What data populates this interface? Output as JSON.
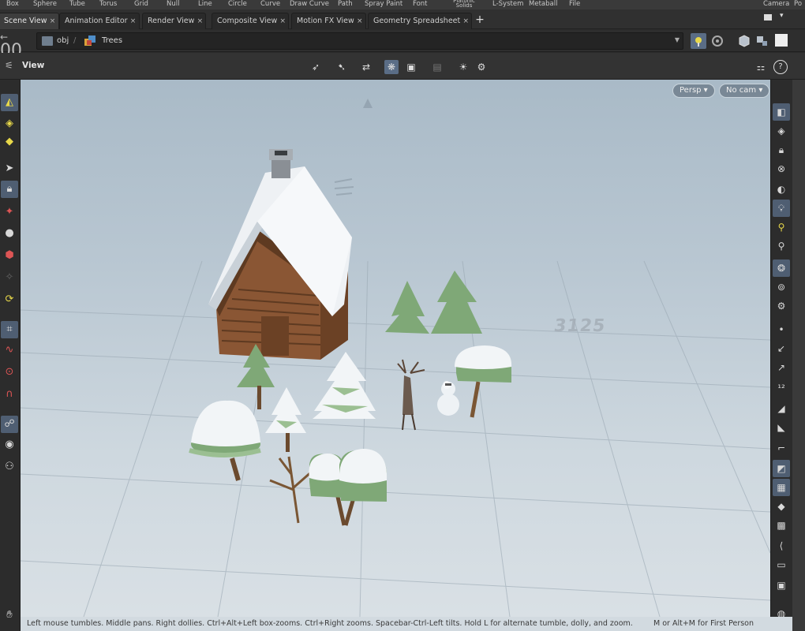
{
  "shelf": {
    "items": [
      "Box",
      "Sphere",
      "Tube",
      "Torus",
      "Grid",
      "Null",
      "Line",
      "Circle",
      "Curve",
      "Draw Curve",
      "Path",
      "Spray Paint",
      "Font",
      "Solids",
      "L-System",
      "Metaball",
      "File",
      "Camera",
      "Po"
    ],
    "platonic_top": "Platonic"
  },
  "tabs": [
    {
      "label": "Scene View",
      "active": true
    },
    {
      "label": "Animation Editor",
      "active": false
    },
    {
      "label": "Render View",
      "active": false
    },
    {
      "label": "Composite View",
      "active": false
    },
    {
      "label": "Motion FX View",
      "active": false
    },
    {
      "label": "Geometry Spreadsheet",
      "active": false
    }
  ],
  "tab_close_glyph": "×",
  "tab_add_glyph": "+",
  "pathbar": {
    "segments": [
      "obj",
      "Trees"
    ],
    "frame_glyph": "00"
  },
  "viewer": {
    "label": "View",
    "persp_button": "Persp ▾",
    "cam_button": "No cam ▾",
    "overlay_number": "3125"
  },
  "status_bar": {
    "hint": "Left mouse tumbles. Middle pans. Right dollies. Ctrl+Alt+Left box-zooms. Ctrl+Right zooms. Spacebar-Ctrl-Left tilts. Hold L for alternate tumble, dolly, and zoom.",
    "hint_right": "M or Alt+M for First Person"
  },
  "colors": {
    "sky_top": "#a9bac7",
    "ground": "#d9e0e5",
    "cabin_wood": "#8a5634",
    "snow": "#f4f6f8",
    "foliage": "#7fa877",
    "selection_blue": "#5a6d86"
  }
}
